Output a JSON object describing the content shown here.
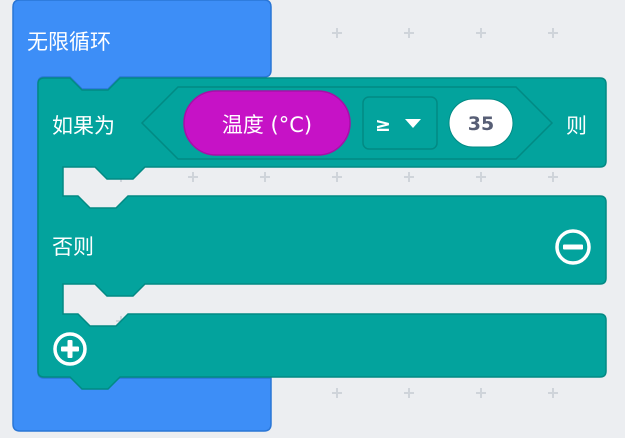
{
  "forever_block": {
    "label": "无限循环",
    "color": "#3d8ef7",
    "border": "#2a76d6"
  },
  "if_block": {
    "if_label": "如果为",
    "then_label": "则",
    "else_label": "否则",
    "color": "#03a39d",
    "border": "#028a84"
  },
  "condition": {
    "sensor_label": "温度 (°C)",
    "sensor_color": "#c612c6",
    "operator": "≥",
    "operator_dropdown_icon": "caret-down-icon",
    "value": "35"
  },
  "controls": {
    "remove_else_icon": "minus-circle-icon",
    "add_branch_icon": "plus-circle-icon"
  }
}
